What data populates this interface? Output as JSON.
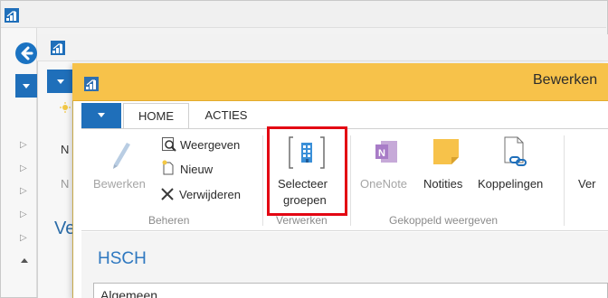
{
  "colors": {
    "accent_blue": "#1f6fba",
    "title_yellow": "#f7c24a",
    "highlight_red": "#e30613",
    "link_blue": "#2e78c0"
  },
  "outer_window": {
    "logo_icon": "app-logo-icon",
    "back_icon": "back-arrow-icon"
  },
  "middle_window": {
    "logo_icon": "app-logo-icon",
    "peek_new": "N",
    "peek_n2": "N",
    "peek_ve": "Ve"
  },
  "front_window": {
    "title": "Bewerken",
    "tabs": [
      {
        "label": "HOME",
        "active": true
      },
      {
        "label": "ACTIES",
        "active": false
      }
    ],
    "groups": [
      {
        "label": "Beheren",
        "buttons": [
          {
            "label": "Bewerken",
            "icon": "pencil-icon",
            "disabled": true
          },
          {
            "label": "Weergeven",
            "icon": "view-icon"
          },
          {
            "label": "Nieuw",
            "icon": "new-icon"
          },
          {
            "label": "Verwijderen",
            "icon": "delete-icon"
          }
        ]
      },
      {
        "label": "Verwerken",
        "buttons": [
          {
            "label_line1": "Selecteer",
            "label_line2": "groepen",
            "icon": "select-groups-icon"
          }
        ]
      },
      {
        "label": "Gekoppeld weergeven",
        "buttons": [
          {
            "label": "OneNote",
            "icon": "onenote-icon",
            "disabled": true
          },
          {
            "label": "Notities",
            "icon": "notes-icon"
          },
          {
            "label": "Koppelingen",
            "icon": "links-icon"
          },
          {
            "label": "Ver",
            "icon": "more-icon"
          }
        ]
      }
    ],
    "record_title": "HSCH",
    "section_title": "Algemeen"
  }
}
